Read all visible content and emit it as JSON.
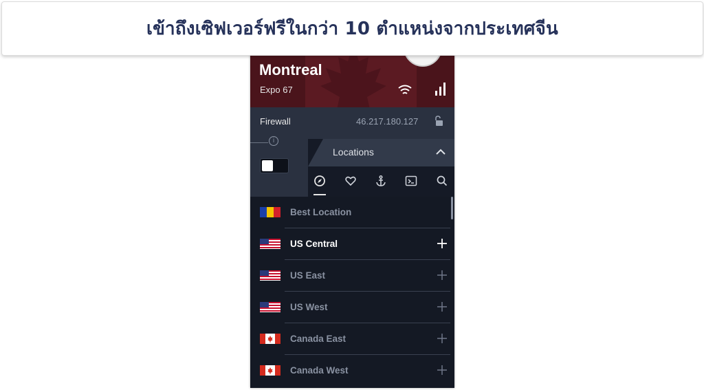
{
  "banner": {
    "text": "เข้าถึงเซิฟเวอร์ฟรีในกว่า 10 ตำแหน่งจากประเทศจีน"
  },
  "app": {
    "hero": {
      "city": "Montreal",
      "server": "Expo 67",
      "flag_colors": {
        "red": "#5b1a22",
        "dark": "#4a141b"
      }
    },
    "firewall": {
      "label": "Firewall",
      "ip": "46.217.180.127"
    },
    "locations": {
      "title": "Locations",
      "tabs": [
        {
          "icon": "compass-icon",
          "active": true
        },
        {
          "icon": "heart-icon",
          "active": false
        },
        {
          "icon": "anchor-icon",
          "active": false
        },
        {
          "icon": "terminal-icon",
          "active": false
        },
        {
          "icon": "search-icon",
          "active": false
        }
      ],
      "items": [
        {
          "label": "Best Location",
          "flag": "romania",
          "active": false,
          "has_plus": false
        },
        {
          "label": "US Central",
          "flag": "usa",
          "active": true,
          "has_plus": true
        },
        {
          "label": "US East",
          "flag": "usa",
          "active": false,
          "has_plus": true
        },
        {
          "label": "US West",
          "flag": "usa",
          "active": false,
          "has_plus": true
        },
        {
          "label": "Canada East",
          "flag": "canada",
          "active": false,
          "has_plus": true
        },
        {
          "label": "Canada West",
          "flag": "canada",
          "active": false,
          "has_plus": true
        }
      ]
    }
  },
  "colors": {
    "banner_text": "#26325a",
    "app_bg": "#151a26",
    "panel": "#2a3140",
    "muted_text": "#8a92a2"
  }
}
